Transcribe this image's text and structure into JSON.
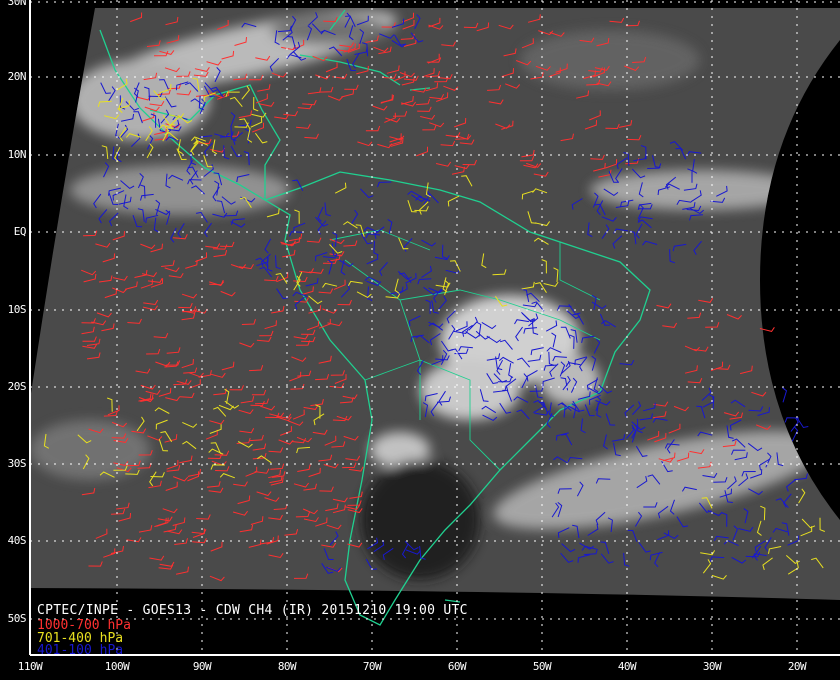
{
  "title": "CPTEC/INPE - GOES13 - CDW CH4 (IR) 20151210 19:00 UTC",
  "legend": [
    {
      "label": "1000-700 hPa",
      "color": "#ff3030"
    },
    {
      "label": "701-400 hPa",
      "color": "#e8e020"
    },
    {
      "label": "401-100 hPa",
      "color": "#1818d0"
    }
  ],
  "lat_labels": [
    "30N",
    "20N",
    "10N",
    "EQ",
    "10S",
    "20S",
    "30S",
    "40S",
    "50S"
  ],
  "lon_labels": [
    "110W",
    "100W",
    "90W",
    "80W",
    "70W",
    "60W",
    "50W",
    "40W",
    "30W",
    "20W"
  ],
  "colors": {
    "coastline": "#20d090",
    "grid": "#ffffff",
    "background": "#000000"
  }
}
